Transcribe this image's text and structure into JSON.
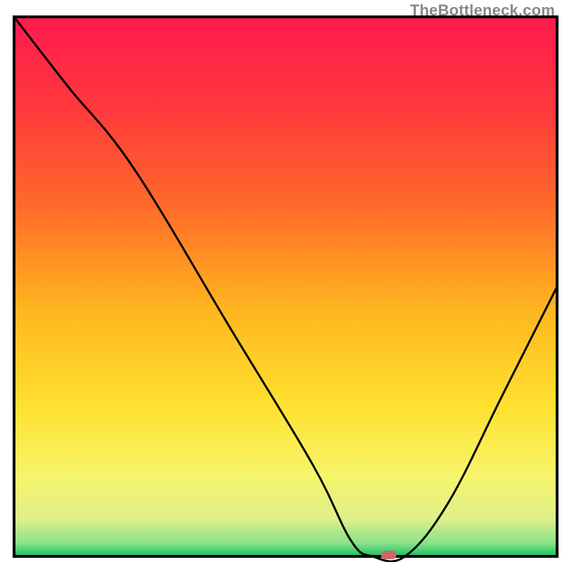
{
  "watermark": "TheBottleneck.com",
  "chart_data": {
    "type": "line",
    "title": "",
    "xlabel": "",
    "ylabel": "",
    "xlim": [
      0,
      100
    ],
    "ylim": [
      0,
      100
    ],
    "grid": false,
    "legend": false,
    "series": [
      {
        "name": "curve",
        "x": [
          0,
          10,
          22,
          40,
          55,
          62,
          66,
          72,
          80,
          90,
          100
        ],
        "values": [
          100,
          87,
          72,
          42,
          17,
          3,
          0,
          0,
          10,
          30,
          50
        ]
      }
    ],
    "marker": {
      "x": 69,
      "y": 0,
      "color": "#c66"
    },
    "gradient_stops": [
      {
        "offset": 0,
        "color": "#ff1a4d"
      },
      {
        "offset": 0.18,
        "color": "#ff3b3b"
      },
      {
        "offset": 0.35,
        "color": "#ff6a2a"
      },
      {
        "offset": 0.55,
        "color": "#ffb81f"
      },
      {
        "offset": 0.72,
        "color": "#ffe030"
      },
      {
        "offset": 0.85,
        "color": "#f6f56a"
      },
      {
        "offset": 0.93,
        "color": "#dff08a"
      },
      {
        "offset": 0.975,
        "color": "#8be28b"
      },
      {
        "offset": 1.0,
        "color": "#18c060"
      }
    ],
    "border_color": "#000",
    "curve_color": "#000",
    "curve_stroke_width": 3
  }
}
